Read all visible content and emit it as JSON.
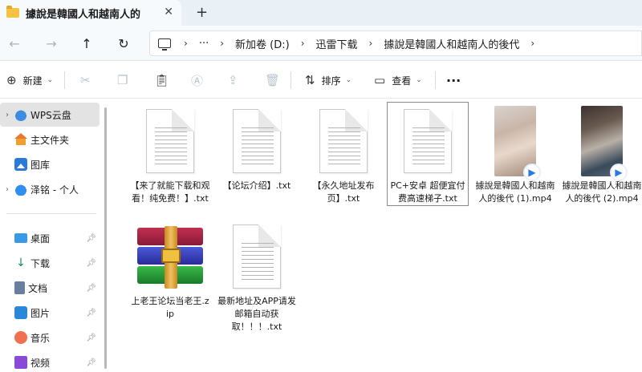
{
  "tab": {
    "title": "據說是韓國人和越南人的",
    "close": "✕",
    "new": "+"
  },
  "nav": {
    "back": "←",
    "forward": "→",
    "up": "↑",
    "refresh": "↻"
  },
  "address": {
    "more": "···",
    "sep": "›",
    "crumbs": [
      "新加卷 (D:)",
      "迅雷下载",
      "據說是韓國人和越南人的後代"
    ]
  },
  "toolbar": {
    "new_label": "新建",
    "sort_label": "排序",
    "view_label": "查看",
    "more": "···"
  },
  "sidebar": {
    "items": [
      {
        "label": "WPS云盘"
      },
      {
        "label": "主文件夹"
      },
      {
        "label": "图库"
      },
      {
        "label": "泽铭 - 个人"
      },
      {
        "label": "桌面"
      },
      {
        "label": "下载"
      },
      {
        "label": "文档"
      },
      {
        "label": "图片"
      },
      {
        "label": "音乐"
      },
      {
        "label": "视频"
      }
    ]
  },
  "files": [
    {
      "name": "【来了就能下载和观看！纯免费！】.txt",
      "type": "txt"
    },
    {
      "name": "【论坛介绍】.txt",
      "type": "txt"
    },
    {
      "name": "【永久地址发布页】.txt",
      "type": "txt"
    },
    {
      "name": "PC+安卓 超便宜付费高速梯子.txt",
      "type": "txt",
      "selected": true
    },
    {
      "name": "據說是韓國人和越南人的後代 (1).mp4",
      "type": "mp4"
    },
    {
      "name": "據說是韓國人和越南人的後代 (2).mp4",
      "type": "mp4"
    },
    {
      "name": "上老王论坛当老王.zip",
      "type": "zip"
    },
    {
      "name": "最新地址及APP请发邮箱自动获取！！！.txt",
      "type": "txt"
    }
  ],
  "colors": {
    "accent": "#2a7ae0",
    "titlebar": "#e9f1f6",
    "selected": "#e3e3e3"
  }
}
